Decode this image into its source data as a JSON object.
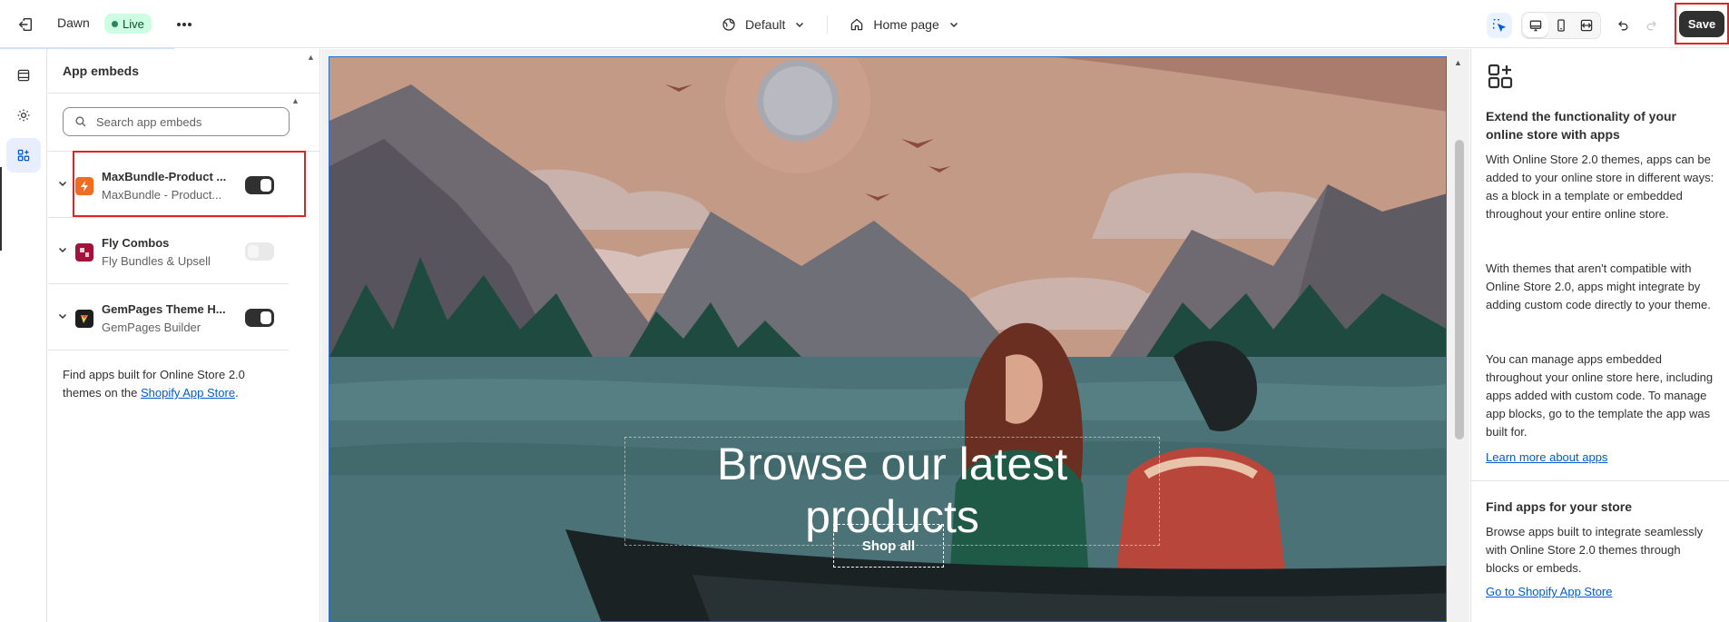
{
  "topbar": {
    "theme_name": "Dawn",
    "live_badge": "Live",
    "template_label": "Default",
    "page_label": "Home page",
    "save_label": "Save"
  },
  "sidebar": {
    "title": "App embeds",
    "search_placeholder": "Search app embeds",
    "apps": [
      {
        "name": "MaxBundle-Product ...",
        "subtitle": "MaxBundle - Product...",
        "enabled": true,
        "logo_color": "#f26b21"
      },
      {
        "name": "Fly Combos",
        "subtitle": "Fly Bundles & Upsell",
        "enabled": false,
        "logo_color": "#a3123a"
      },
      {
        "name": "GemPages Theme H...",
        "subtitle": "GemPages Builder",
        "enabled": true,
        "logo_color": "#1f1f1f"
      }
    ],
    "footer_text": "Find apps built for Online Store 2.0 themes on the ",
    "footer_link": "Shopify App Store",
    "footer_end": "."
  },
  "preview": {
    "hero_title": "Browse our latest products",
    "hero_button": "Shop all"
  },
  "info_panel": {
    "heading": "Extend the functionality of your online store with apps",
    "para1": "With Online Store 2.0 themes, apps can be added to your online store in different ways: as a block in a template or embedded throughout your entire online store.",
    "para2": "With themes that aren't compatible with Online Store 2.0, apps might integrate by adding custom code directly to your theme.",
    "para3": "You can manage apps embedded throughout your online store here, including apps added with custom code. To manage app blocks, go to the template the app was built for.",
    "learn_link": "Learn more about apps",
    "find_heading": "Find apps for your store",
    "find_para": "Browse apps built to integrate seamlessly with Online Store 2.0 themes through blocks or embeds.",
    "store_link": "Go to Shopify App Store"
  },
  "colors": {
    "accent": "#005bd3",
    "highlight": "#e02424",
    "live_bg": "#cdfee1"
  }
}
